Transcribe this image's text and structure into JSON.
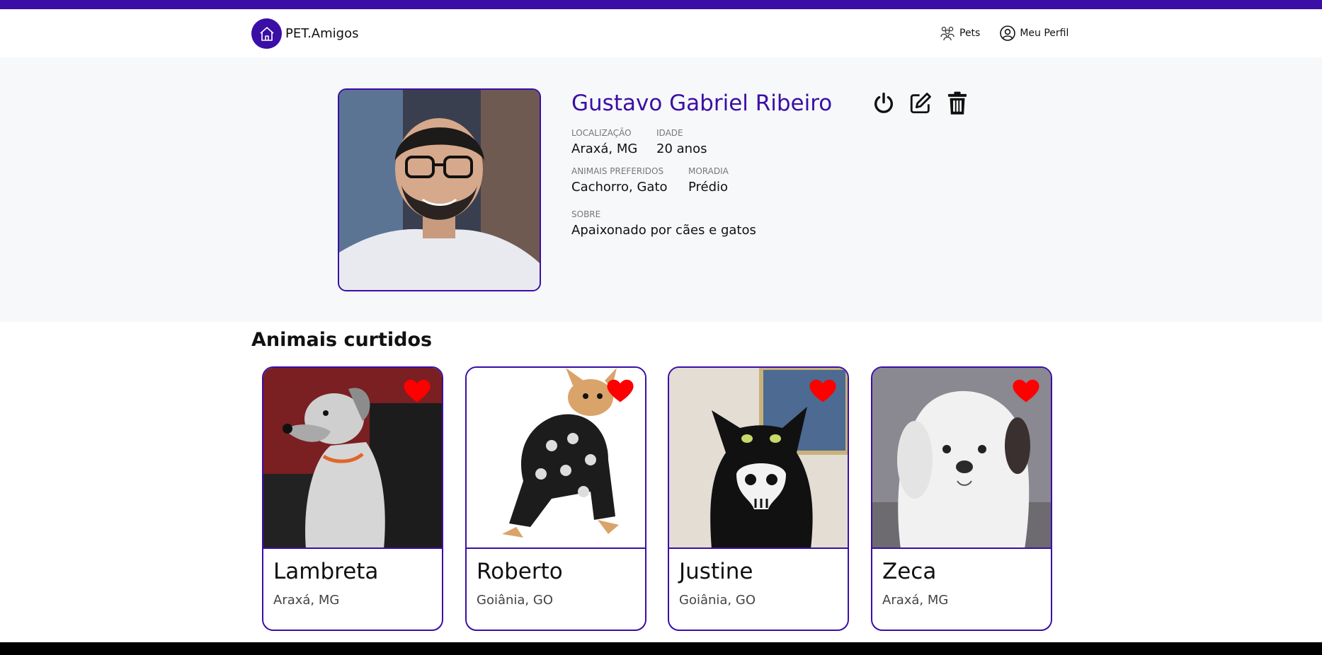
{
  "app": {
    "brand": "PET.Amigos",
    "brand_color": "#3b0ea6"
  },
  "nav": {
    "items": [
      {
        "label": "Pets",
        "icon": "pets-group-icon"
      },
      {
        "label": "Meu Perfil",
        "icon": "user-circle-icon"
      }
    ]
  },
  "profile": {
    "name": "Gustavo Gabriel Ribeiro",
    "fields": {
      "location": {
        "label": "Localização",
        "value": "Araxá, MG"
      },
      "age": {
        "label": "Idade",
        "value": "20 anos"
      },
      "preferred": {
        "label": "Animais preferidos",
        "value": "Cachorro, Gato"
      },
      "housing": {
        "label": "Moradia",
        "value": "Prédio"
      },
      "about": {
        "label": "Sobre",
        "value": "Apaixonado por cães e gatos"
      }
    },
    "actions": [
      "power-icon",
      "edit-icon",
      "trash-icon"
    ]
  },
  "liked": {
    "title": "Animais curtidos",
    "heart_color": "#ff0000",
    "pets": [
      {
        "name": "Lambreta",
        "location": "Araxá, MG"
      },
      {
        "name": "Roberto",
        "location": "Goiânia, GO"
      },
      {
        "name": "Justine",
        "location": "Goiânia, GO"
      },
      {
        "name": "Zeca",
        "location": "Araxá, MG"
      }
    ]
  }
}
